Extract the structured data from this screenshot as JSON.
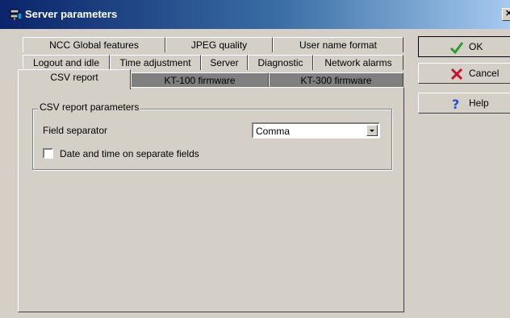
{
  "window": {
    "title": "Server parameters",
    "close_glyph": "✕"
  },
  "tabs": {
    "row1": [
      "NCC Global features",
      "JPEG quality",
      "User name format"
    ],
    "row2": [
      "Logout and idle",
      "Time adjustment",
      "Server",
      "Diagnostic",
      "Network alarms"
    ],
    "row3": [
      "CSV report",
      "KT-100 firmware",
      "KT-300 firmware"
    ],
    "selected": "CSV report"
  },
  "csv_report": {
    "group_title": "CSV report parameters",
    "field_separator_label": "Field separator",
    "field_separator_value": "Comma",
    "date_time_label": "Date and time on separate fields",
    "date_time_checked": false
  },
  "buttons": {
    "ok": "OK",
    "cancel": "Cancel",
    "help": "Help"
  },
  "icons": {
    "title": "server-config-icon",
    "ok": "green-checkmark-icon",
    "cancel": "red-x-icon",
    "help": "blue-question-mark-icon"
  },
  "colors": {
    "title_bar_start": "#0a246a",
    "title_bar_end": "#a6caf0",
    "dialog_face": "#d4d0c8",
    "ok_icon": "#2e9b2e",
    "cancel_icon": "#c8102e",
    "help_icon": "#1d4fd8"
  }
}
